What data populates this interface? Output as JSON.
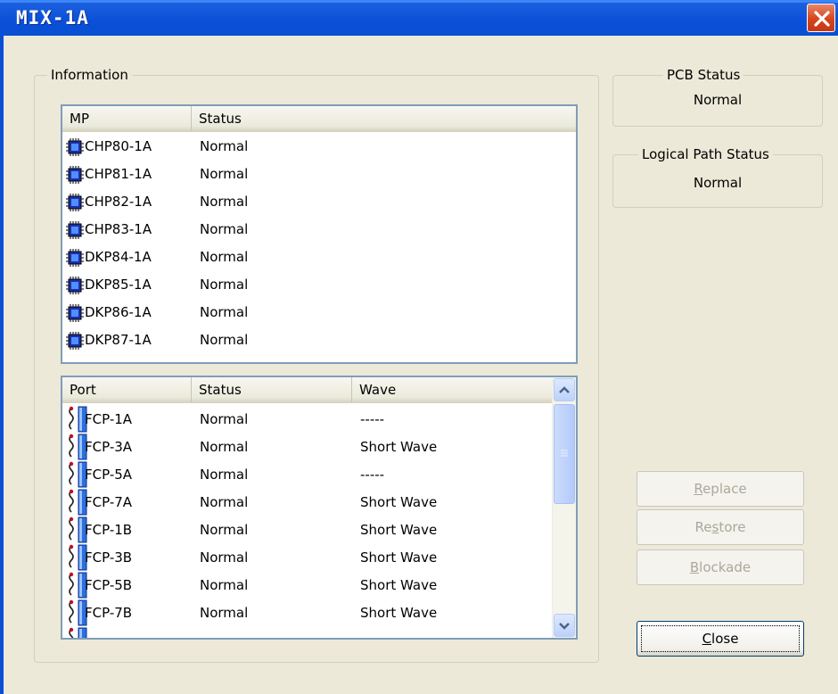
{
  "window": {
    "title": "MIX-1A"
  },
  "information": {
    "label": "Information",
    "mp_table": {
      "headers": [
        "MP",
        "Status"
      ],
      "rows": [
        {
          "name": "CHP80-1A",
          "status": "Normal"
        },
        {
          "name": "CHP81-1A",
          "status": "Normal"
        },
        {
          "name": "CHP82-1A",
          "status": "Normal"
        },
        {
          "name": "CHP83-1A",
          "status": "Normal"
        },
        {
          "name": "DKP84-1A",
          "status": "Normal"
        },
        {
          "name": "DKP85-1A",
          "status": "Normal"
        },
        {
          "name": "DKP86-1A",
          "status": "Normal"
        },
        {
          "name": "DKP87-1A",
          "status": "Normal"
        }
      ]
    },
    "port_table": {
      "headers": [
        "Port",
        "Status",
        "Wave"
      ],
      "rows": [
        {
          "name": "FCP-1A",
          "status": "Normal",
          "wave": "-----"
        },
        {
          "name": "FCP-3A",
          "status": "Normal",
          "wave": "Short Wave"
        },
        {
          "name": "FCP-5A",
          "status": "Normal",
          "wave": "-----"
        },
        {
          "name": "FCP-7A",
          "status": "Normal",
          "wave": "Short Wave"
        },
        {
          "name": "FCP-1B",
          "status": "Normal",
          "wave": "Short Wave"
        },
        {
          "name": "FCP-3B",
          "status": "Normal",
          "wave": "Short Wave"
        },
        {
          "name": "FCP-5B",
          "status": "Normal",
          "wave": "Short Wave"
        },
        {
          "name": "FCP-7B",
          "status": "Normal",
          "wave": "Short Wave"
        }
      ]
    }
  },
  "pcb_status": {
    "label": "PCB Status",
    "value": "Normal"
  },
  "logical_path_status": {
    "label": "Logical Path Status",
    "value": "Normal"
  },
  "buttons": {
    "replace": {
      "pre": "",
      "key": "R",
      "post": "eplace"
    },
    "restore": {
      "pre": "Re",
      "key": "s",
      "post": "tore"
    },
    "blockade": {
      "pre": "",
      "key": "B",
      "post": "lockade"
    },
    "close": {
      "pre": "",
      "key": "C",
      "post": "lose"
    }
  }
}
